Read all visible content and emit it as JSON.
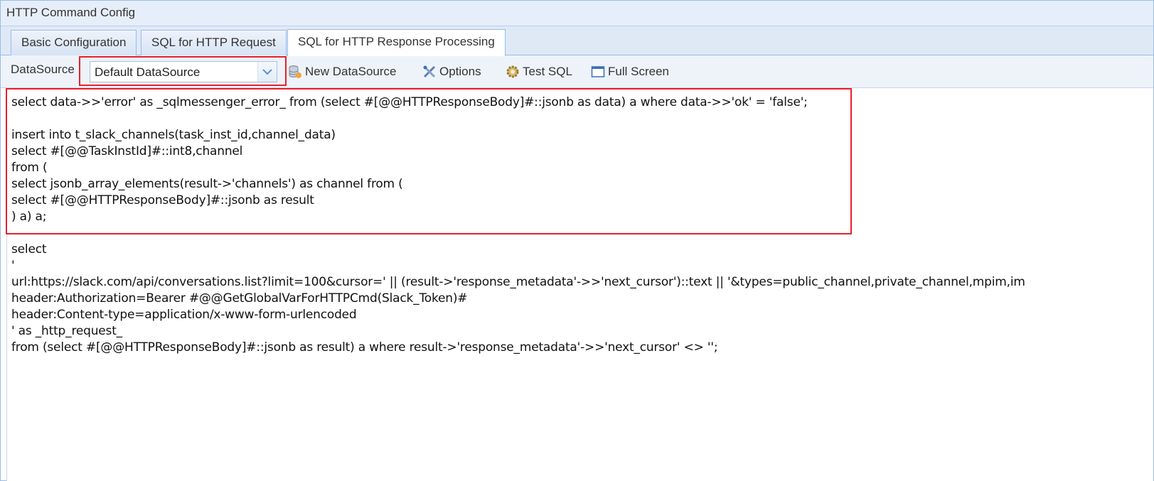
{
  "window": {
    "title": "HTTP Command Config"
  },
  "tabs": [
    {
      "label": "Basic Configuration",
      "active": false
    },
    {
      "label": "SQL for HTTP Request",
      "active": false
    },
    {
      "label": "SQL for HTTP Response Processing",
      "active": true
    }
  ],
  "toolbar": {
    "datasource_label": "DataSource",
    "datasource_value": "Default DataSource",
    "new_datasource_label": "New DataSource",
    "options_label": "Options",
    "test_sql_label": "Test SQL",
    "full_screen_label": "Full Screen",
    "icons": {
      "new_datasource": "database-icon",
      "options": "tools-icon",
      "test_sql": "gear-icon",
      "full_screen": "window-icon",
      "dropdown": "chevron-down-icon"
    }
  },
  "editor": {
    "lines": [
      "select data->>'error' as _sqlmessenger_error_ from (select #[@@HTTPResponseBody]#::jsonb as data) a where data->>'ok' = 'false';",
      "",
      "insert into t_slack_channels(task_inst_id,channel_data)",
      "select #[@@TaskInstId]#::int8,channel",
      "from (",
      "select jsonb_array_elements(result->'channels') as channel from (",
      "select #[@@HTTPResponseBody]#::jsonb as result",
      ") a) a;",
      "",
      "select",
      "'",
      "url:https://slack.com/api/conversations.list?limit=100&cursor=' || (result->'response_metadata'->>'next_cursor')::text || '&types=public_channel,private_channel,mpim,im",
      "header:Authorization=Bearer #@@GetGlobalVarForHTTPCmd(Slack_Token)#",
      "header:Content-type=application/x-www-form-urlencoded",
      "' as _http_request_",
      "from (select #[@@HTTPResponseBody]#::jsonb as result) a where result->'response_metadata'->>'next_cursor' <> '';"
    ]
  },
  "colors": {
    "highlight": "#e8202a",
    "border": "#99bbe8",
    "title_bg": "#e6eef9"
  }
}
